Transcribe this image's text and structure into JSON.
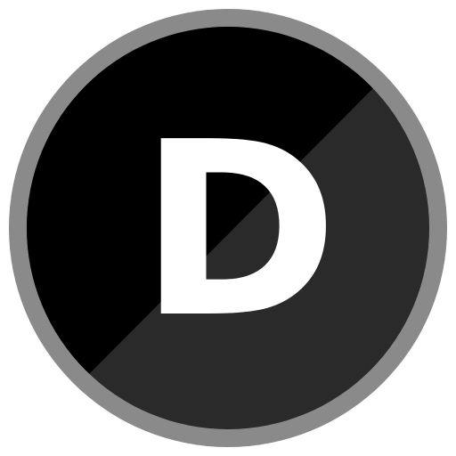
{
  "logo": {
    "letter": "D",
    "colors": {
      "ring": "#8a8a8a",
      "dark_half": "#000000",
      "light_half": "#2a2a2a",
      "letter": "#ffffff"
    }
  }
}
